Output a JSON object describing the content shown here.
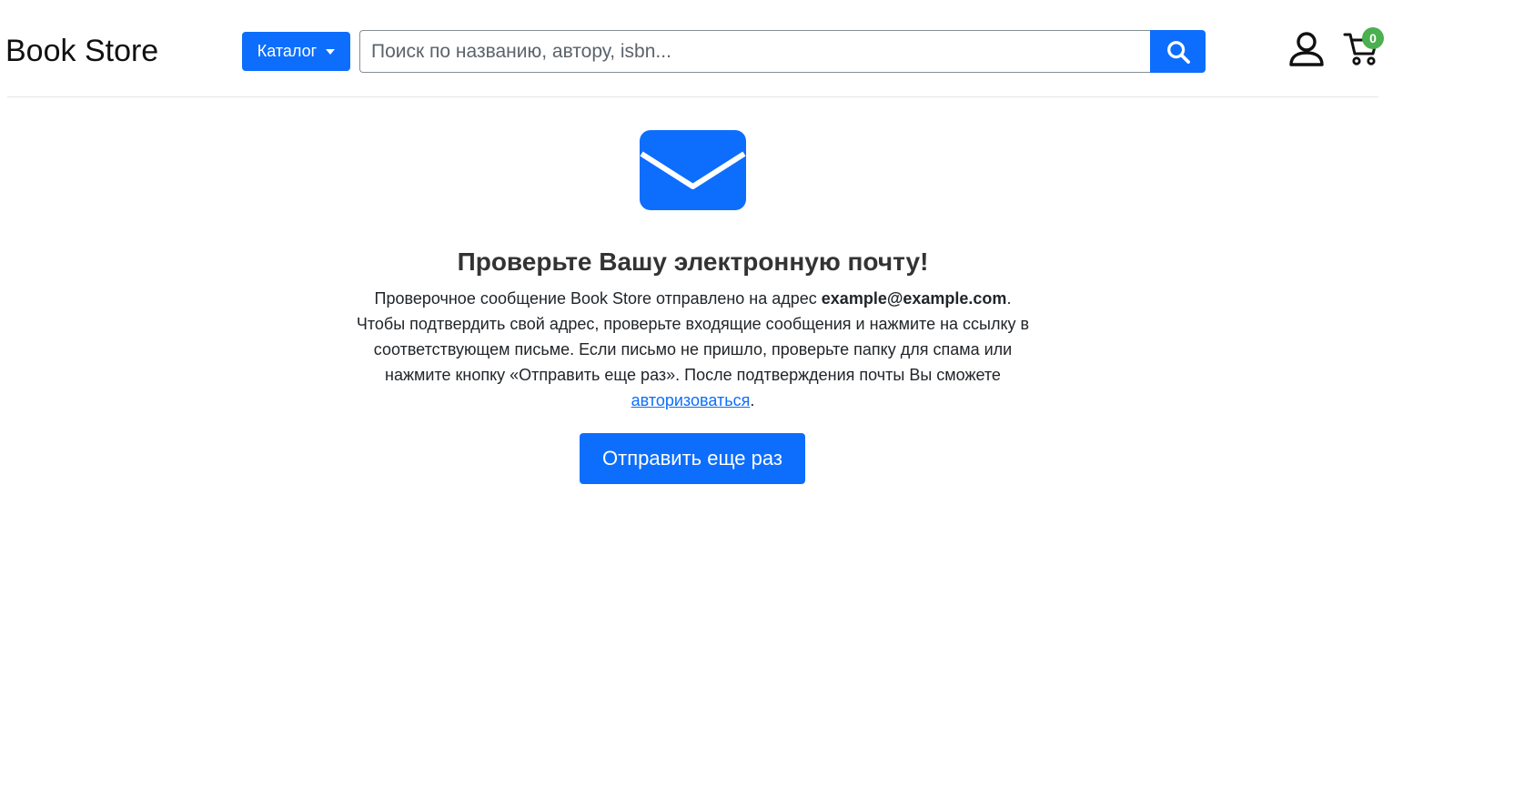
{
  "header": {
    "brand": "Book Store",
    "catalog_label": "Каталог",
    "search_placeholder": "Поиск по названию, автору, isbn...",
    "search_value": "",
    "cart_count": "0"
  },
  "main": {
    "title": "Проверьте Вашу электронную почту!",
    "message_part1": "Проверочное сообщение Book Store отправлено на адрес ",
    "email": "example@example.com",
    "message_part2": ". Чтобы подтвердить свой адрес, проверьте входящие сообщения и нажмите на ссылку в соответствующем письме. Если письмо не пришло, проверьте папку для спама или нажмите кнопку «Отправить еще раз». После подтверждения почты Вы сможете ",
    "login_link": "авторизоваться",
    "message_part3": ".",
    "resend_label": "Отправить еще раз"
  },
  "icons": {
    "search": "search-icon",
    "user": "user-icon",
    "cart": "cart-icon",
    "envelope": "envelope-icon",
    "dropdown": "caret-down-icon"
  },
  "colors": {
    "primary": "#0d6efd",
    "badge": "#4caf50",
    "title": "#333333"
  }
}
